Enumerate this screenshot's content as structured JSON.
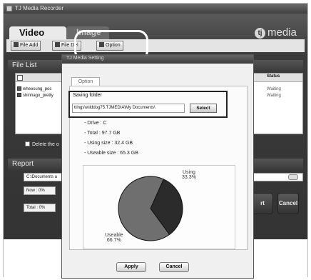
{
  "app": {
    "title": "TJ Media Recorder",
    "brand": "media",
    "brand_logo": "tj"
  },
  "tabs": [
    {
      "label": "Video",
      "active": true
    },
    {
      "label": "Image",
      "active": false
    }
  ],
  "toolbar": {
    "file_add": "File Add",
    "file_del": "File Del",
    "option": "Option"
  },
  "file_list": {
    "title": "File List",
    "status_header": "Status",
    "rows": [
      {
        "name": "wheesung_pos",
        "status": "Waiting"
      },
      {
        "name": "shinhago_pretty",
        "status": "Waiting"
      }
    ],
    "delete_label": "Delete the o"
  },
  "report": {
    "title": "Report",
    "path": "C:\\Documents a",
    "now_label": "Now : 0%",
    "total_label": "Total : 0%",
    "start_label": "rt",
    "cancel_label": "Cancel"
  },
  "dialog": {
    "title": "TJ Media Setting",
    "tab": "Option",
    "saving_folder_label": "Saving folder",
    "folder_path": "ttings\\wilddog75.TJMEDIA\\My Documents\\",
    "select_label": "Select",
    "drive": "- Drive : C",
    "total": "- Total : 97.7 GB",
    "using": "- Using size : 32.4 GB",
    "useable": "- Useable size : 65.3 GB",
    "apply": "Apply",
    "cancel": "Cancel"
  },
  "chart_data": {
    "type": "pie",
    "labels": [
      "Using",
      "Useable"
    ],
    "values": [
      33.3,
      66.7
    ],
    "value_labels": [
      "33.3%",
      "66.7%"
    ],
    "colors": [
      "#2b2b2b",
      "#6f6f6f"
    ]
  }
}
